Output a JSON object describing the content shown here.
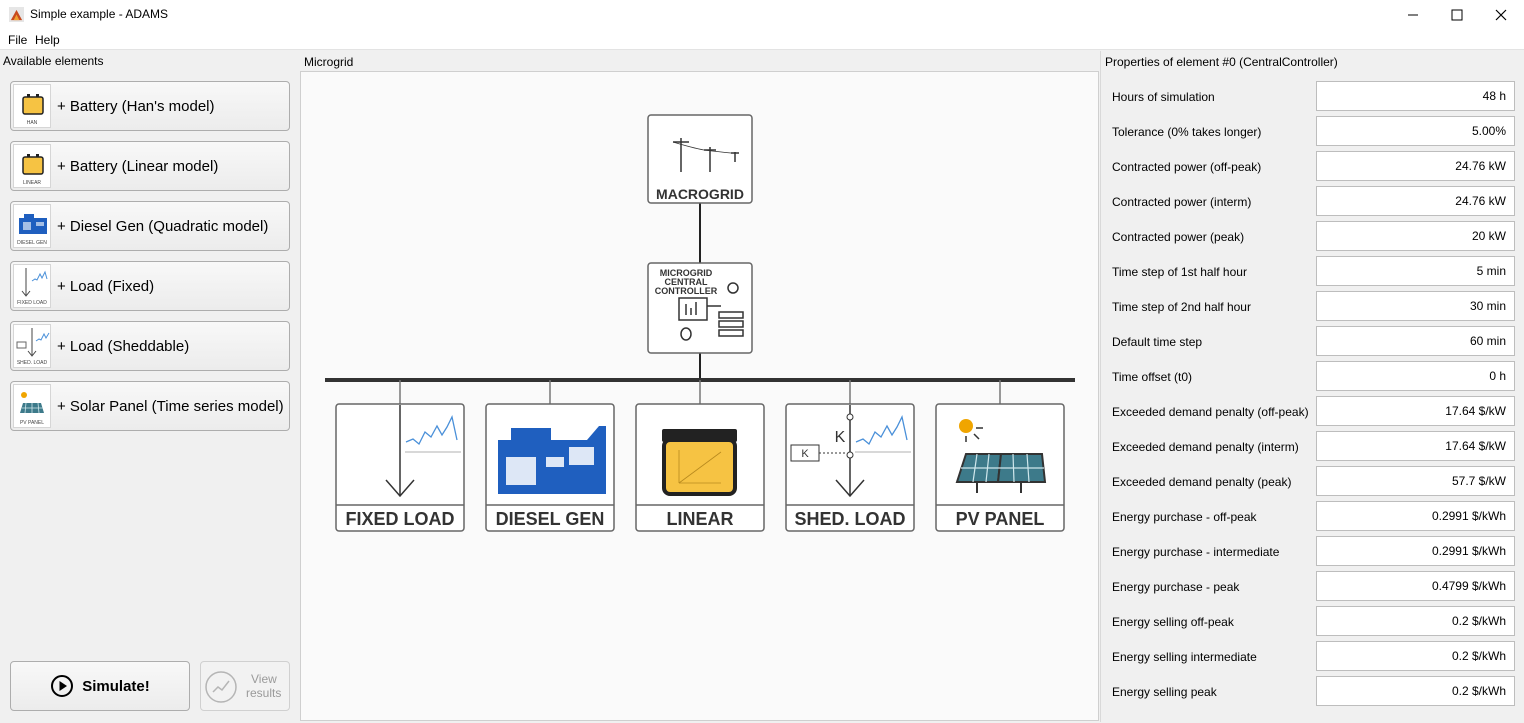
{
  "window": {
    "title": "Simple example - ADAMS"
  },
  "menu": [
    "File",
    "Help"
  ],
  "left": {
    "header": "Available elements",
    "elements": [
      {
        "label": "+ Battery (Han's model)",
        "thumb": "HAN",
        "icon": "battery-icon"
      },
      {
        "label": "+ Battery (Linear model)",
        "thumb": "LINEAR",
        "icon": "battery-icon"
      },
      {
        "label": "+ Diesel Gen (Quadratic model)",
        "thumb": "DIESEL GEN",
        "icon": "generator-icon"
      },
      {
        "label": "+ Load (Fixed)",
        "thumb": "FIXED LOAD",
        "icon": "load-icon"
      },
      {
        "label": "+ Load (Sheddable)",
        "thumb": "SHED. LOAD",
        "icon": "load-icon"
      },
      {
        "label": "+ Solar Panel (Time series model)",
        "thumb": "PV PANEL",
        "icon": "solar-icon"
      }
    ],
    "simulate_label": "Simulate!",
    "view_results_line1": "View",
    "view_results_line2": "results"
  },
  "center": {
    "header": "Microgrid",
    "macrogrid_label": "MACROGRID",
    "controller_line1": "MICROGRID",
    "controller_line2": "CENTRAL",
    "controller_line3": "CONTROLLER",
    "nodes": [
      "FIXED LOAD",
      "DIESEL GEN",
      "LINEAR",
      "SHED. LOAD",
      "PV PANEL"
    ],
    "switch_label": "K"
  },
  "right": {
    "header": "Properties of element #0 (CentralController)",
    "properties": [
      {
        "label": "Hours of simulation",
        "value": "48 h"
      },
      {
        "label": "Tolerance (0% takes longer)",
        "value": "5.00%"
      },
      {
        "label": "Contracted power (off-peak)",
        "value": "24.76 kW"
      },
      {
        "label": "Contracted power (interm)",
        "value": "24.76 kW"
      },
      {
        "label": "Contracted power (peak)",
        "value": "20 kW"
      },
      {
        "label": "Time step of 1st half hour",
        "value": "5 min"
      },
      {
        "label": "Time step of 2nd half hour",
        "value": "30 min"
      },
      {
        "label": "Default time step",
        "value": "60 min"
      },
      {
        "label": "Time offset (t0)",
        "value": "0 h"
      },
      {
        "label": "Exceeded demand penalty (off-peak)",
        "value": "17.64 $/kW"
      },
      {
        "label": "Exceeded demand penalty (interm)",
        "value": "17.64 $/kW"
      },
      {
        "label": "Exceeded demand penalty (peak)",
        "value": "57.7 $/kW"
      },
      {
        "label": "Energy purchase - off-peak",
        "value": "0.2991 $/kWh"
      },
      {
        "label": "Energy purchase - intermediate",
        "value": "0.2991 $/kWh"
      },
      {
        "label": "Energy purchase - peak",
        "value": "0.4799 $/kWh"
      },
      {
        "label": "Energy selling off-peak",
        "value": "0.2 $/kWh"
      },
      {
        "label": "Energy selling intermediate",
        "value": "0.2 $/kWh"
      },
      {
        "label": "Energy selling peak",
        "value": "0.2 $/kWh"
      }
    ]
  },
  "colors": {
    "diesel": "#1f5fbf",
    "battery": "#f6c343",
    "pv": "#3d7a8a",
    "sun": "#f0a500"
  }
}
